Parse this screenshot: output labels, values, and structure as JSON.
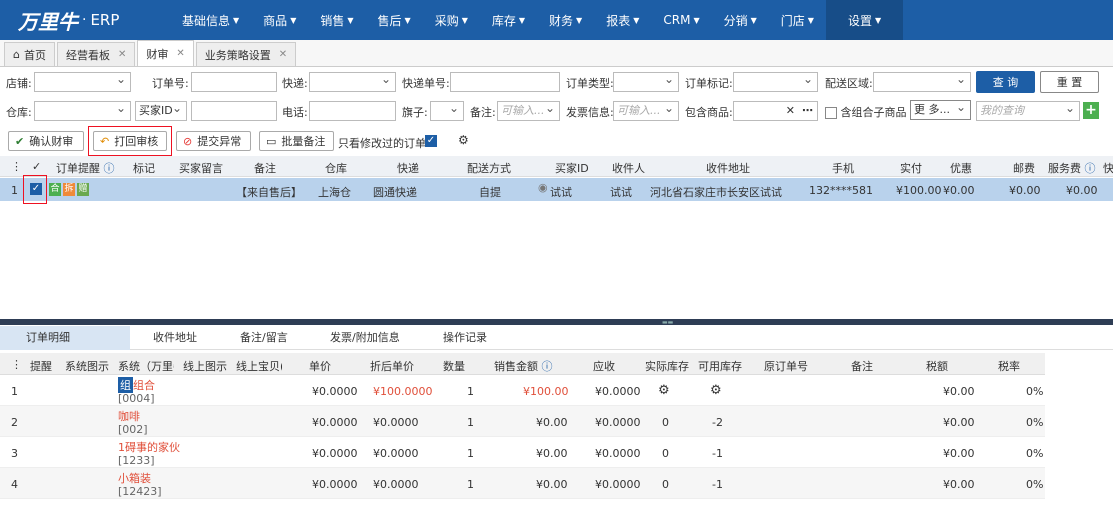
{
  "nav": {
    "logo_main": "万里牛",
    "logo_dot": "·",
    "logo_erp": "ERP",
    "items": [
      "基础信息",
      "商品",
      "销售",
      "售后",
      "采购",
      "库存",
      "财务",
      "报表",
      "CRM",
      "分销",
      "门店",
      "设置"
    ]
  },
  "tabs": [
    {
      "label": "首页"
    },
    {
      "label": "经营看板"
    },
    {
      "label": "财审"
    },
    {
      "label": "业务策略设置"
    }
  ],
  "filters": {
    "shop": "店铺:",
    "order_no": "订单号:",
    "express": "快递:",
    "express_no": "快递单号:",
    "order_type": "订单类型:",
    "order_mark": "订单标记:",
    "region": "配送区域:",
    "query": "查 询",
    "reset": "重 置",
    "warehouse": "仓库:",
    "buyer_id": "买家ID",
    "phone": "电话:",
    "flag": "旗子:",
    "remark": "备注:",
    "remark_ph": "可输入...",
    "invoice": "发票信息:",
    "invoice_ph": "可输入...",
    "contains": "包含商品:",
    "combo": "含组合子商品",
    "more": "更 多...",
    "my_query": "我的查询"
  },
  "toolbar": {
    "confirm": "确认财审",
    "print_back": "打回审核",
    "submit_err": "提交异常",
    "batch_remark": "批量备注",
    "only_modified": "只看修改过的订单"
  },
  "grid": {
    "headers": [
      "订单提醒",
      "标记",
      "买家留言",
      "备注",
      "仓库",
      "快递",
      "配送方式",
      "买家ID",
      "收件人",
      "收件地址",
      "手机",
      "实付",
      "优惠",
      "邮费",
      "服务费",
      "快"
    ],
    "row": {
      "idx": "1",
      "tag1": "合",
      "tag2": "拆",
      "tag3": "赠",
      "remark": "【来自售后】",
      "warehouse": "上海仓",
      "express": "圆通快递",
      "ship": "自提",
      "buyer": "试试",
      "recipient": "试试",
      "address": "河北省石家庄市长安区试试",
      "mobile": "132****581",
      "paid": "¥100.00",
      "discount": "¥0.00",
      "postage": "¥0.00",
      "service": "¥0.00"
    }
  },
  "bottom_tabs": [
    "订单明细",
    "收件地址",
    "备注/留言",
    "发票/附加信息",
    "操作记录"
  ],
  "detail": {
    "headers": [
      "提醒",
      "系统图示",
      "系统（万里牛",
      "线上图示",
      "线上宝贝(",
      "单价",
      "折后单价",
      "数量",
      "销售金额",
      "应收",
      "实际库存",
      "可用库存",
      "原订单号",
      "备注",
      "税额",
      "税率"
    ],
    "rows": [
      {
        "idx": "1",
        "badge": "组",
        "name": "组合",
        "code": "[0004]",
        "price": "¥0.0000",
        "disc": "¥100.0000",
        "qty": "1",
        "amount": "¥100.00",
        "recv": "¥0.0000",
        "stock": "",
        "avail": "",
        "tax": "¥0.00",
        "rate": "0%"
      },
      {
        "idx": "2",
        "badge": "",
        "name": "咖啡",
        "code": "[002]",
        "price": "¥0.0000",
        "disc": "¥0.0000",
        "qty": "1",
        "amount": "¥0.00",
        "recv": "¥0.0000",
        "stock": "0",
        "avail": "-2",
        "tax": "¥0.00",
        "rate": "0%"
      },
      {
        "idx": "3",
        "badge": "",
        "name": "1碍事的家伙",
        "code": "[1233]",
        "price": "¥0.0000",
        "disc": "¥0.0000",
        "qty": "1",
        "amount": "¥0.00",
        "recv": "¥0.0000",
        "stock": "0",
        "avail": "-1",
        "tax": "¥0.00",
        "rate": "0%"
      },
      {
        "idx": "4",
        "badge": "",
        "name": "小箱装",
        "code": "[12423]",
        "price": "¥0.0000",
        "disc": "¥0.0000",
        "qty": "1",
        "amount": "¥0.00",
        "recv": "¥0.0000",
        "stock": "0",
        "avail": "-1",
        "tax": "¥0.00",
        "rate": "0%"
      }
    ]
  }
}
